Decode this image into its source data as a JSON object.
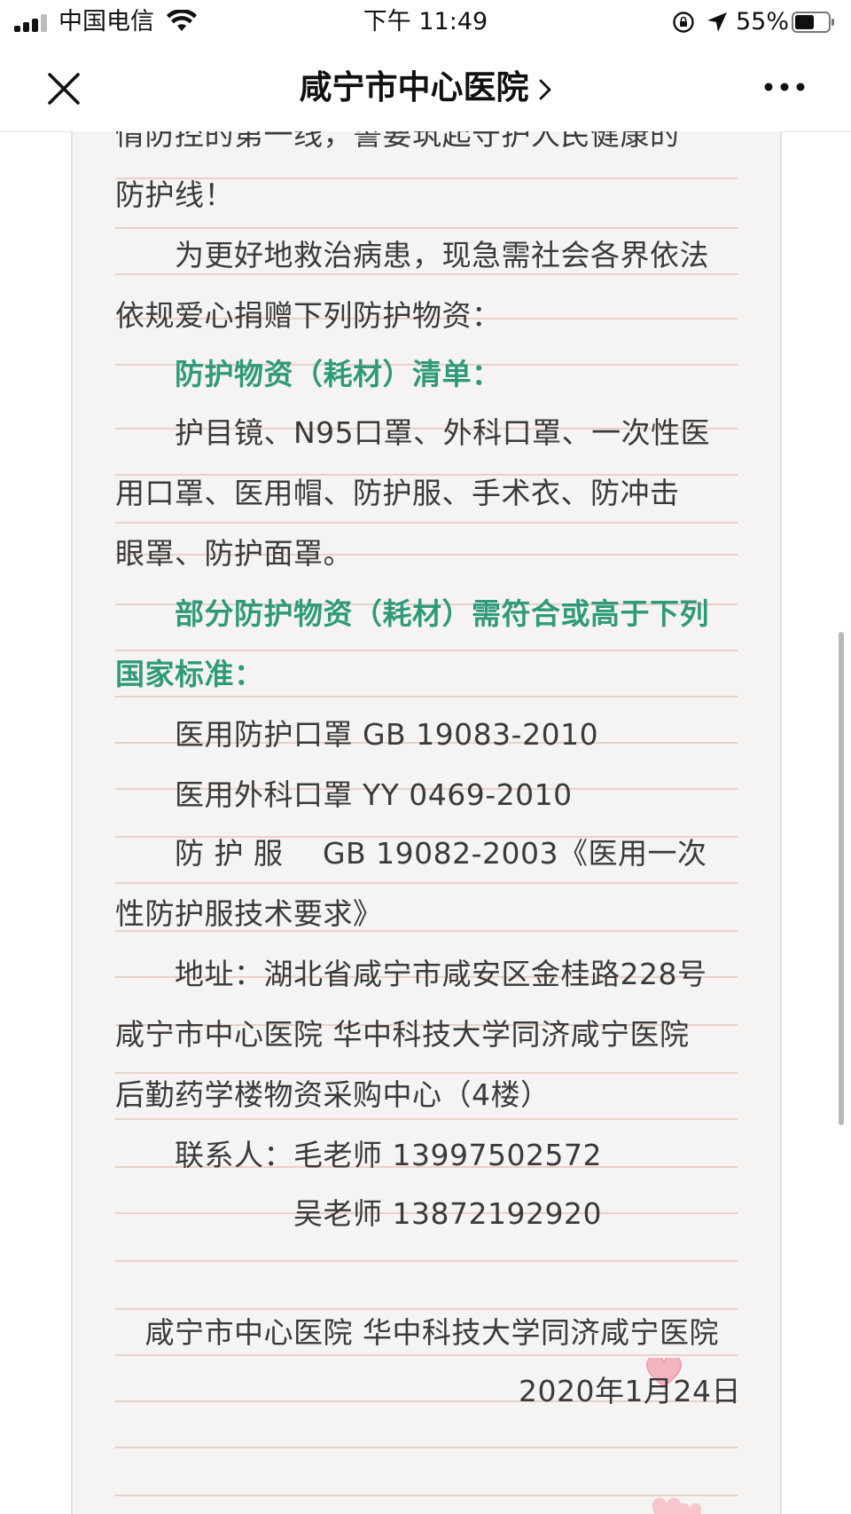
{
  "status_bar": {
    "carrier": "中国电信",
    "time": "下午 11:49",
    "battery": "55%"
  },
  "nav": {
    "title": "咸宁市中心医院"
  },
  "article": {
    "lines": [
      {
        "text": "情防控的第一线，誓要筑起守护人民健康的",
        "green": false,
        "clipped_top": true
      },
      {
        "text": "防护线！",
        "green": false
      },
      {
        "text": "　　为更好地救治病患，现急需社会各界依法",
        "green": false
      },
      {
        "text": "依规爱心捐赠下列防护物资：",
        "green": false
      },
      {
        "text": "　　防护物资（耗材）清单：",
        "green": true
      },
      {
        "text": "　　护目镜、N95口罩、外科口罩、一次性医",
        "green": false
      },
      {
        "text": "用口罩、医用帽、防护服、手术衣、防冲击",
        "green": false
      },
      {
        "text": "眼罩、防护面罩。",
        "green": false
      },
      {
        "text": "　　部分防护物资（耗材）需符合或高于下列",
        "green": true
      },
      {
        "text": "国家标准：",
        "green": true
      },
      {
        "text": "　　医用防护口罩 GB 19083-2010",
        "green": false
      },
      {
        "text": "　　医用外科口罩 YY 0469-2010",
        "green": false
      },
      {
        "text": "　　防 护 服 　GB 19082-2003《医用一次",
        "green": false
      },
      {
        "text": "性防护服技术要求》",
        "green": false
      },
      {
        "text": "　　地址：湖北省咸宁市咸安区金桂路228号",
        "green": false
      },
      {
        "text": "咸宁市中心医院 华中科技大学同济咸宁医院",
        "green": false
      },
      {
        "text": "后勤药学楼物资采购中心（4楼）",
        "green": false
      },
      {
        "text": "　　联系人：毛老师 13997502572",
        "green": false
      },
      {
        "text": "　　　　　　吴老师 13872192920",
        "green": false
      },
      {
        "text": "",
        "green": false
      },
      {
        "text": "　咸宁市中心医院 华中科技大学同济咸宁医院",
        "green": false
      },
      {
        "text": "2020年1月24日",
        "green": false,
        "align_right": true
      }
    ]
  },
  "colors": {
    "paper": "#f6f4f2",
    "rule": "#ead0cb",
    "green_heading": "#2f9a7a",
    "body_text": "#3a3a3a"
  },
  "icons": [
    "close-icon",
    "chevron-right-icon",
    "more-icon",
    "signal-icon",
    "wifi-icon",
    "rotation-lock-icon",
    "location-icon",
    "battery-icon",
    "heart-icon"
  ]
}
